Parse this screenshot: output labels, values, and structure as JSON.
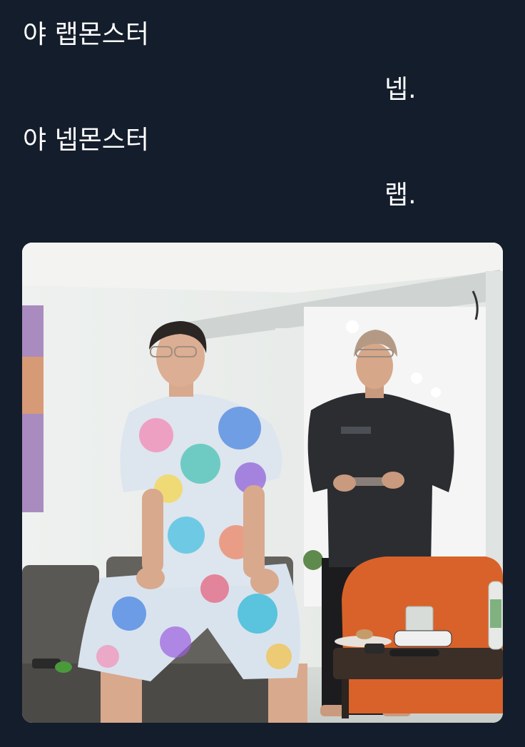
{
  "tweet": {
    "lines": [
      "야 랩몬스터",
      "넵.",
      "야 넵몬스터",
      "랩."
    ]
  },
  "media": {
    "kind": "photo",
    "description_icon": "photo-icon"
  },
  "colors": {
    "background": "#141d2b",
    "text": "#ffffff",
    "sofa_orange": "#d8622a",
    "wall": "#eef0ee"
  }
}
